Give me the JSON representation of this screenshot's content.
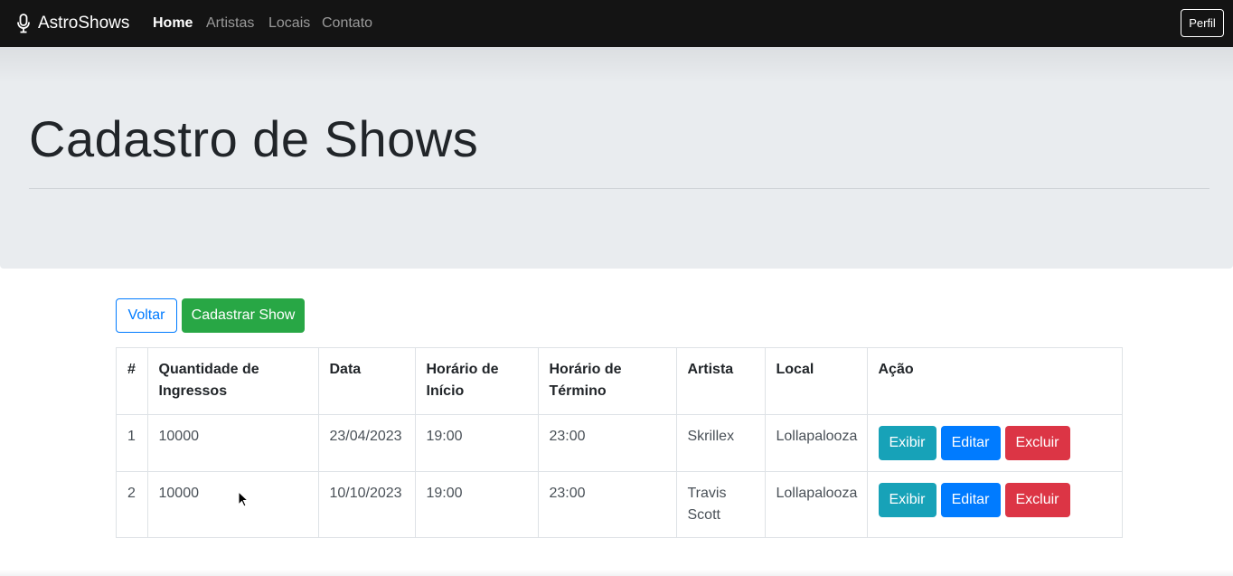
{
  "navbar": {
    "brand": "AstroShows",
    "brand_icon": "microphone-icon",
    "links": [
      {
        "label": "Home",
        "active": true
      },
      {
        "label": "Artistas",
        "active": false
      },
      {
        "label": "Locais",
        "active": false
      },
      {
        "label": "Contato",
        "active": false
      }
    ],
    "profile_button": "Perfil"
  },
  "header": {
    "title": "Cadastro de Shows"
  },
  "actions": {
    "back_label": "Voltar",
    "create_label": "Cadastrar Show"
  },
  "table": {
    "headers": [
      "#",
      "Quantidade de Ingressos",
      "Data",
      "Horário de Início",
      "Horário de Término",
      "Artista",
      "Local",
      "Ação"
    ],
    "rows": [
      {
        "id": "1",
        "tickets": "10000",
        "date": "23/04/2023",
        "start": "19:00",
        "end": "23:00",
        "artist": "Skrillex",
        "venue": "Lollapalooza"
      },
      {
        "id": "2",
        "tickets": "10000",
        "date": "10/10/2023",
        "start": "19:00",
        "end": "23:00",
        "artist": "Travis Scott",
        "venue": "Lollapalooza"
      }
    ],
    "row_actions": {
      "view": "Exibir",
      "edit": "Editar",
      "delete": "Excluir"
    }
  },
  "colors": {
    "navbar_bg": "#141414",
    "jumbotron_bg": "#e9ecef",
    "primary": "#007bff",
    "success": "#28a745",
    "info": "#17a2b8",
    "danger": "#dc3545"
  }
}
